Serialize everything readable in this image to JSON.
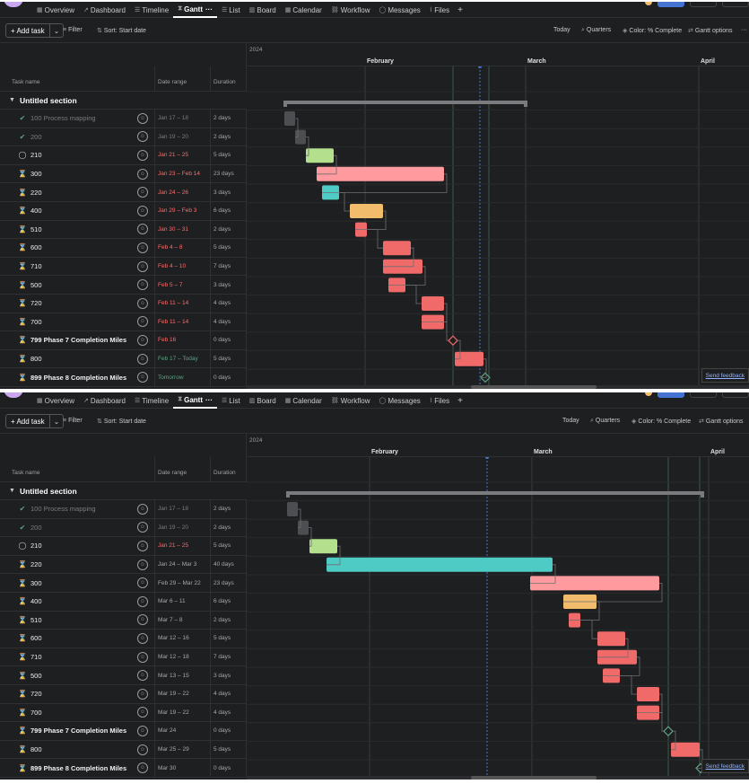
{
  "nav": {
    "tabs": [
      {
        "label": "Overview",
        "icon": "calendar-icon"
      },
      {
        "label": "Dashboard",
        "icon": "chart-line-icon"
      },
      {
        "label": "Timeline",
        "icon": "timeline-icon"
      },
      {
        "label": "Gantt",
        "icon": "gantt-icon",
        "active": true,
        "more": "···"
      },
      {
        "label": "List",
        "icon": "list-icon"
      },
      {
        "label": "Board",
        "icon": "board-icon"
      },
      {
        "label": "Calendar",
        "icon": "calendar-icon"
      },
      {
        "label": "Workflow",
        "icon": "workflow-icon"
      },
      {
        "label": "Messages",
        "icon": "message-icon"
      },
      {
        "label": "Files",
        "icon": "paperclip-icon"
      }
    ],
    "plus": "+"
  },
  "toolbar": {
    "add_task": "+ Add task",
    "add_task_chevron": "⌄",
    "filter": "Filter",
    "sort": "Sort: Start date",
    "today": "Today",
    "quarters": "Quarters",
    "color": "Color: % Complete",
    "gantt_options": "Gantt options",
    "more": "···"
  },
  "columns": {
    "task": "Task name",
    "date": "Date range",
    "duration": "Duration"
  },
  "section_title": "Untitled section",
  "year": "2024",
  "months": [
    "February",
    "March",
    "April"
  ],
  "feedback": "Send feedback",
  "colors": {
    "grey": "#4d4e51",
    "green": "#b4e08e",
    "pink": "#ff9a9e",
    "teal": "#4ecbc4",
    "orange": "#f1bd6c",
    "red": "#f06a6a",
    "bracket": "#7a7b7e",
    "today_line": "#4573d2",
    "milestone": "#5da283"
  },
  "panels": [
    {
      "tasks": [
        {
          "name": "100 Process mapping",
          "status": "done",
          "date": "Jan 17 – 18",
          "date_color": "grey",
          "duration": "2 days"
        },
        {
          "name": "200",
          "status": "done",
          "date": "Jan 19 – 20",
          "date_color": "grey",
          "duration": "2 days"
        },
        {
          "name": "210",
          "status": "check",
          "date": "Jan 21 – 25",
          "date_color": "red",
          "duration": "5 days"
        },
        {
          "name": "300",
          "status": "hourglass",
          "date": "Jan 23 – Feb 14",
          "date_color": "red",
          "duration": "23 days"
        },
        {
          "name": "220",
          "status": "hourglass",
          "date": "Jan 24 – 26",
          "date_color": "red",
          "duration": "3 days"
        },
        {
          "name": "400",
          "status": "hourglass",
          "date": "Jan 29 – Feb 3",
          "date_color": "red",
          "duration": "6 days"
        },
        {
          "name": "510",
          "status": "hourglass",
          "date": "Jan 30 – 31",
          "date_color": "red",
          "duration": "2 days"
        },
        {
          "name": "600",
          "status": "hourglass",
          "date": "Feb 4 – 8",
          "date_color": "red",
          "duration": "5 days"
        },
        {
          "name": "710",
          "status": "hourglass",
          "date": "Feb 4 – 10",
          "date_color": "red",
          "duration": "7 days"
        },
        {
          "name": "500",
          "status": "hourglass",
          "date": "Feb 5 – 7",
          "date_color": "red",
          "duration": "3 days"
        },
        {
          "name": "720",
          "status": "hourglass",
          "date": "Feb 11 – 14",
          "date_color": "red",
          "duration": "4 days"
        },
        {
          "name": "700",
          "status": "hourglass",
          "date": "Feb 11 – 14",
          "date_color": "red",
          "duration": "4 days"
        },
        {
          "name": "799 Phase 7 Completion Miles",
          "status": "milestone",
          "date": "Feb 16",
          "date_color": "red",
          "duration": "0 days",
          "bold": true
        },
        {
          "name": "800",
          "status": "hourglass",
          "date": "Feb 17 – Today",
          "date_color": "green",
          "duration": "5 days"
        },
        {
          "name": "899 Phase 8 Completion Miles",
          "status": "milestone",
          "date": "Tomorrow",
          "date_color": "green",
          "duration": "0 days",
          "bold": true
        }
      ]
    },
    {
      "tasks": [
        {
          "name": "100 Process mapping",
          "status": "done",
          "date": "Jan 17 – 18",
          "date_color": "grey",
          "duration": "2 days"
        },
        {
          "name": "200",
          "status": "done",
          "date": "Jan 19 – 20",
          "date_color": "grey",
          "duration": "2 days"
        },
        {
          "name": "210",
          "status": "check",
          "date": "Jan 21 – 25",
          "date_color": "red",
          "duration": "5 days"
        },
        {
          "name": "220",
          "status": "hourglass",
          "date": "Jan 24 – Mar 3",
          "date_color": "plain",
          "duration": "40 days"
        },
        {
          "name": "300",
          "status": "hourglass",
          "date": "Feb 29 – Mar 22",
          "date_color": "plain",
          "duration": "23 days"
        },
        {
          "name": "400",
          "status": "hourglass",
          "date": "Mar 6 – 11",
          "date_color": "plain",
          "duration": "6 days"
        },
        {
          "name": "510",
          "status": "hourglass",
          "date": "Mar 7 – 8",
          "date_color": "plain",
          "duration": "2 days"
        },
        {
          "name": "600",
          "status": "hourglass",
          "date": "Mar 12 – 16",
          "date_color": "plain",
          "duration": "5 days"
        },
        {
          "name": "710",
          "status": "hourglass",
          "date": "Mar 12 – 18",
          "date_color": "plain",
          "duration": "7 days"
        },
        {
          "name": "500",
          "status": "hourglass",
          "date": "Mar 13 – 15",
          "date_color": "plain",
          "duration": "3 days"
        },
        {
          "name": "720",
          "status": "hourglass",
          "date": "Mar 19 – 22",
          "date_color": "plain",
          "duration": "4 days"
        },
        {
          "name": "700",
          "status": "hourglass",
          "date": "Mar 19 – 22",
          "date_color": "plain",
          "duration": "4 days"
        },
        {
          "name": "799 Phase 7 Completion Miles",
          "status": "milestone",
          "date": "Mar 24",
          "date_color": "plain",
          "duration": "0 days",
          "bold": true
        },
        {
          "name": "800",
          "status": "hourglass",
          "date": "Mar 25 – 29",
          "date_color": "plain",
          "duration": "5 days"
        },
        {
          "name": "899 Phase 8 Completion Miles",
          "status": "milestone",
          "date": "Mar 30",
          "date_color": "plain",
          "duration": "0 days",
          "bold": true
        }
      ]
    }
  ]
}
